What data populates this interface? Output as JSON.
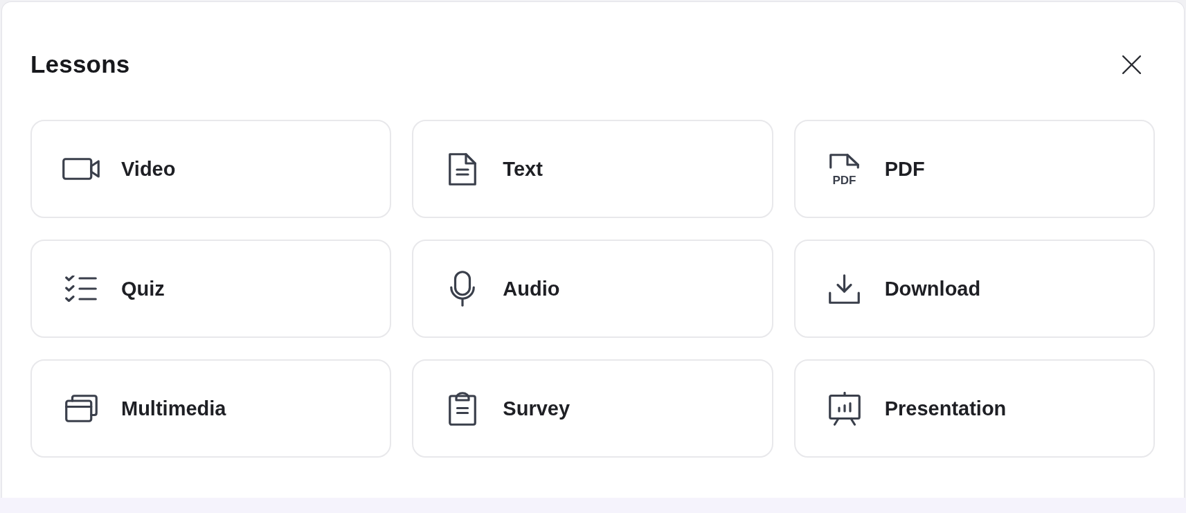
{
  "dialog": {
    "title": "Lessons"
  },
  "lesson_types": [
    {
      "kind": "video",
      "label": "Video"
    },
    {
      "kind": "text",
      "label": "Text"
    },
    {
      "kind": "pdf",
      "label": "PDF",
      "icon_text": "PDF"
    },
    {
      "kind": "quiz",
      "label": "Quiz"
    },
    {
      "kind": "audio",
      "label": "Audio"
    },
    {
      "kind": "download",
      "label": "Download"
    },
    {
      "kind": "multimedia",
      "label": "Multimedia"
    },
    {
      "kind": "survey",
      "label": "Survey"
    },
    {
      "kind": "presentation",
      "label": "Presentation"
    }
  ]
}
